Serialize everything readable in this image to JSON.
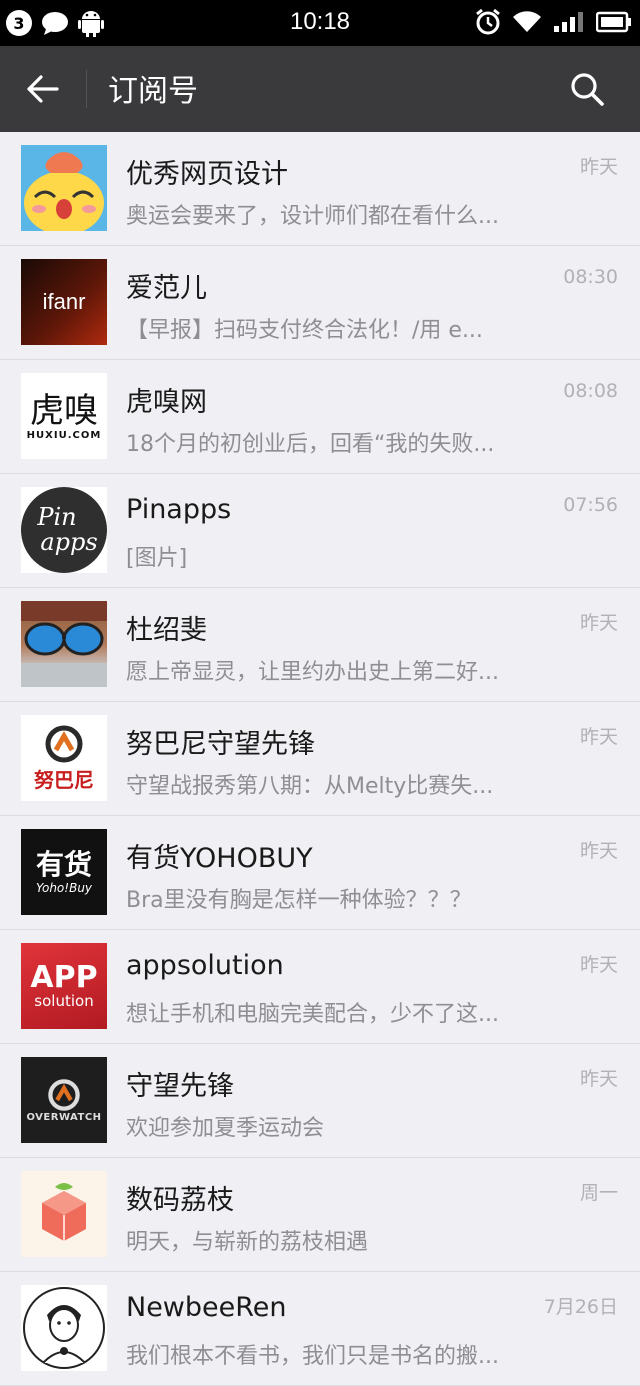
{
  "statusbar": {
    "notification_count": "3",
    "time": "10:18"
  },
  "appbar": {
    "title": "订阅号"
  },
  "items": [
    {
      "name": "优秀网页设计",
      "preview": "奥运会要来了，设计师们都在看什么...",
      "time": "昨天"
    },
    {
      "name": "爱范儿",
      "preview": "【早报】扫码支付终合法化！/用 e...",
      "time": "08:30",
      "avatar_text": "ifanr"
    },
    {
      "name": "虎嗅网",
      "preview": "18个月的初创业后，回看“我的失败...",
      "time": "08:08",
      "avatar_text": "虎嗅",
      "avatar_sub": "HUXIU.COM"
    },
    {
      "name": "Pinapps",
      "preview": "[图片]",
      "time": "07:56",
      "avatar_text": "Pin",
      "avatar_sub": "apps"
    },
    {
      "name": "杜绍斐",
      "preview": "愿上帝显灵，让里约办出史上第二好...",
      "time": "昨天"
    },
    {
      "name": "努巴尼守望先锋",
      "preview": "守望战报秀第八期：从Melty比赛失...",
      "time": "昨天",
      "avatar_text": "努巴尼"
    },
    {
      "name": "有货YOHOBUY",
      "preview": "Bra里没有胸是怎样一种体验？？？",
      "time": "昨天",
      "avatar_text": "有货",
      "avatar_sub": "Yoho!Buy"
    },
    {
      "name": "appsolution",
      "preview": "想让手机和电脑完美配合，少不了这...",
      "time": "昨天",
      "avatar_text": "APP",
      "avatar_sub": "solution"
    },
    {
      "name": "守望先锋",
      "preview": "欢迎参加夏季运动会",
      "time": "昨天",
      "avatar_text": "OVERWATCH"
    },
    {
      "name": "数码荔枝",
      "preview": "明天，与崭新的荔枝相遇",
      "time": "周一"
    },
    {
      "name": "NewbeeRen",
      "preview": "我们根本不看书，我们只是书名的搬...",
      "time": "7月26日"
    }
  ]
}
